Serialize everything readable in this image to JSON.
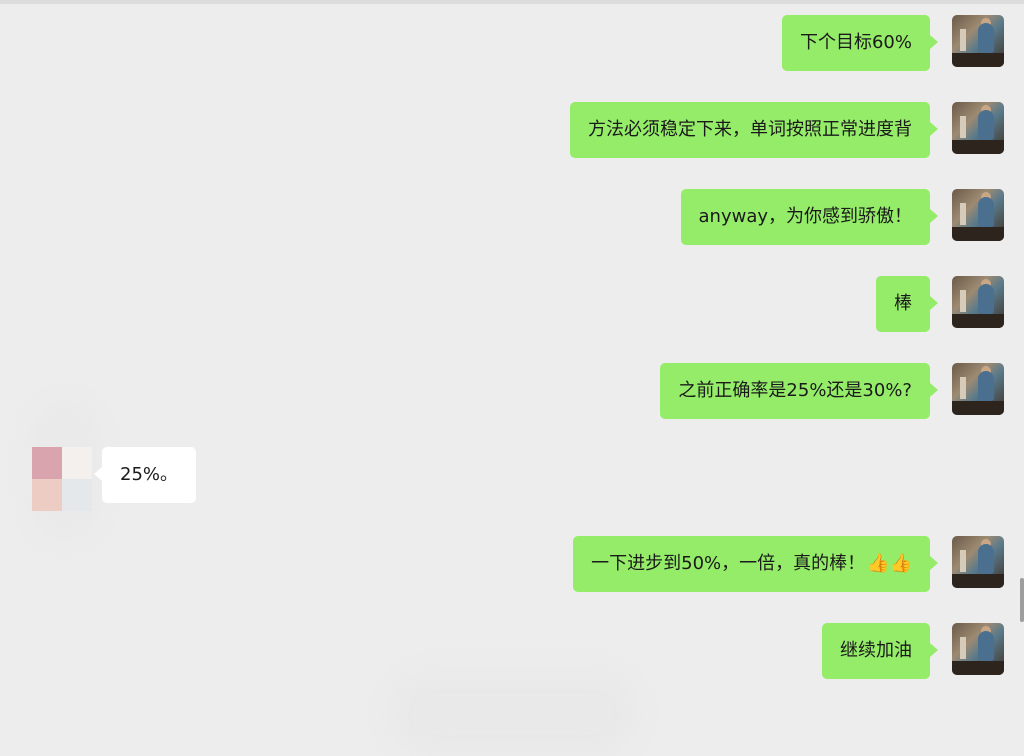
{
  "messages": [
    {
      "direction": "out",
      "text": "下个目标60%"
    },
    {
      "direction": "out",
      "text": "方法必须稳定下来，单词按照正常进度背"
    },
    {
      "direction": "out",
      "text": "anyway，为你感到骄傲！"
    },
    {
      "direction": "out",
      "text": "棒"
    },
    {
      "direction": "out",
      "text": "之前正确率是25%还是30%?"
    },
    {
      "direction": "in",
      "text": "25%。"
    },
    {
      "direction": "out",
      "text": "一下进步到50%，一倍，真的棒！",
      "emoji": "👍👍"
    },
    {
      "direction": "out",
      "text": "继续加油"
    }
  ],
  "colors": {
    "background": "#ededed",
    "outgoing_bubble": "#95ec69",
    "incoming_bubble": "#ffffff"
  },
  "icons": {
    "my_avatar": "user-avatar-photo",
    "other_avatar": "contact-avatar-pixelated",
    "thumbs_up": "thumbs-up-emoji"
  }
}
